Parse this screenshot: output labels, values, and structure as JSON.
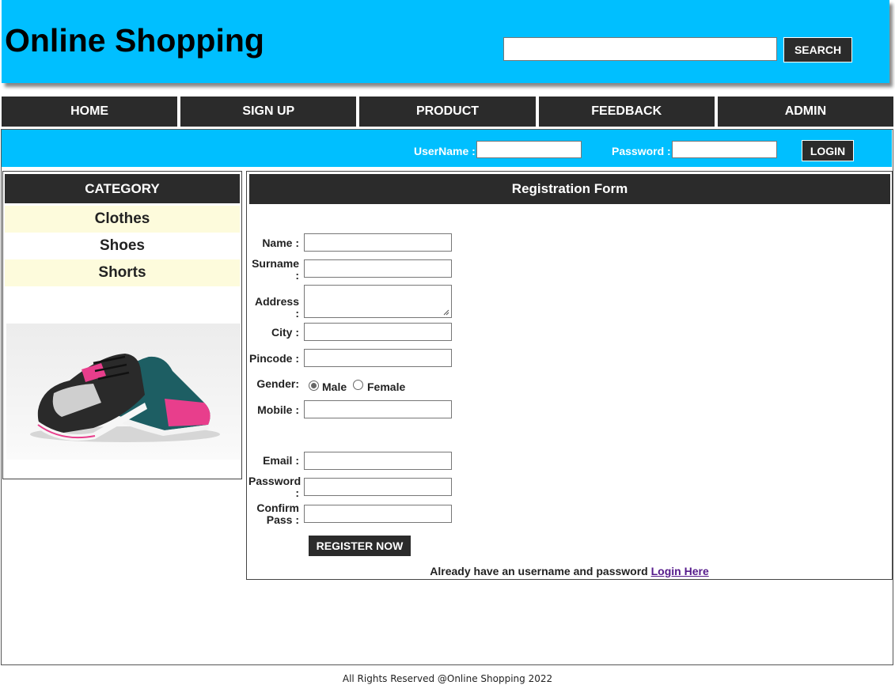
{
  "header": {
    "site_title": "Online Shopping",
    "search_value": "",
    "search_button": "SEARCH"
  },
  "nav": {
    "items": [
      "HOME",
      "SIGN UP",
      "PRODUCT",
      "FEEDBACK",
      "ADMIN"
    ]
  },
  "login_bar": {
    "username_label": "UserName :",
    "password_label": "Password :",
    "login_button": "LOGIN"
  },
  "sidebar": {
    "title": "CATEGORY",
    "items": [
      "Clothes",
      "Shoes",
      "Shorts"
    ]
  },
  "registration": {
    "title": "Registration Form",
    "name_label": "Name :",
    "surname_label": "Surname :",
    "address_label": "Address :",
    "city_label": "City :",
    "pincode_label": "Pincode :",
    "gender_label": "Gender:",
    "gender_options": [
      "Male",
      "Female"
    ],
    "gender_selected": "Male",
    "mobile_label": "Mobile :",
    "email_label": "Email :",
    "password_label": "Password :",
    "confirm_label": "Confirm Pass :",
    "register_button": "REGISTER NOW",
    "login_prompt": "Already have an username and password",
    "login_link": "Login Here"
  },
  "footer": {
    "text": "All Rights Reserved @Online Shopping 2022"
  },
  "colors": {
    "header_bg": "#00bfff",
    "dark": "#2b2b2b",
    "category_alt": "#fdfbdc",
    "link": "#551a8b"
  }
}
